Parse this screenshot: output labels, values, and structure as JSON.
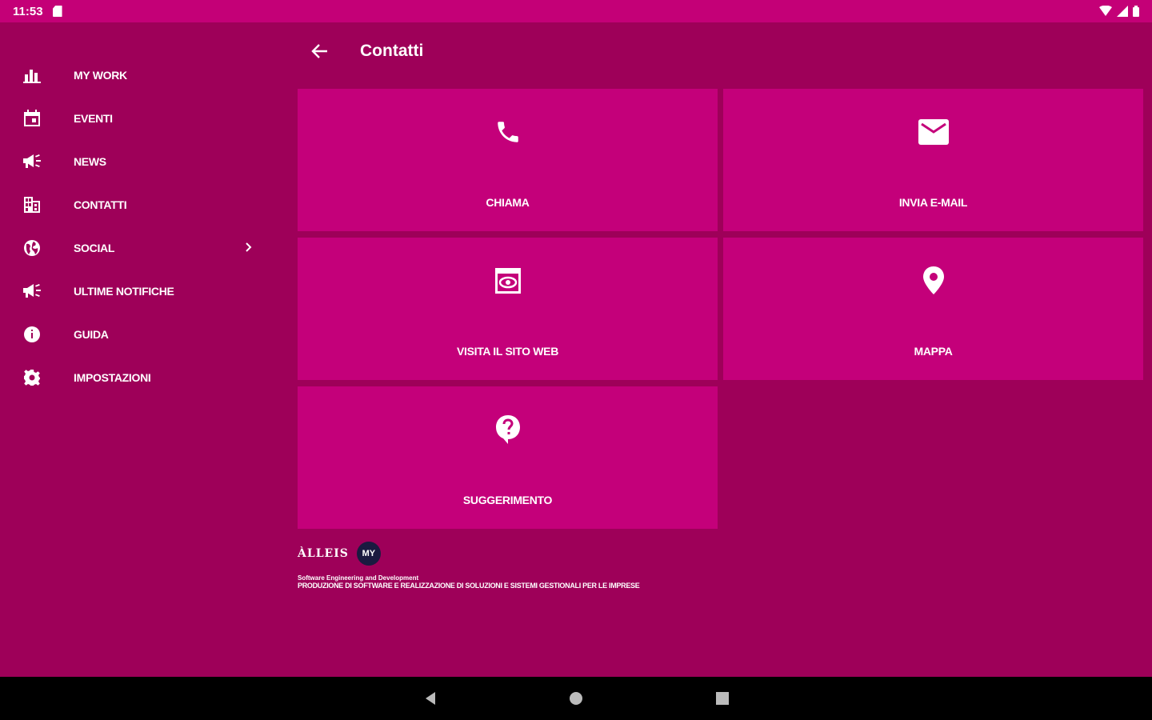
{
  "status_bar": {
    "time": "11:53"
  },
  "drawer": {
    "items": [
      {
        "label": "MY WORK",
        "icon": "bar-chart-icon"
      },
      {
        "label": "EVENTI",
        "icon": "calendar-icon"
      },
      {
        "label": "NEWS",
        "icon": "megaphone-icon"
      },
      {
        "label": "CONTATTI",
        "icon": "business-icon"
      },
      {
        "label": "SOCIAL",
        "icon": "globe-icon"
      },
      {
        "label": "ULTIME NOTIFICHE",
        "icon": "megaphone-icon"
      },
      {
        "label": "GUIDA",
        "icon": "info-icon"
      },
      {
        "label": "IMPOSTAZIONI",
        "icon": "gear-icon"
      }
    ]
  },
  "toolbar": {
    "title": "Contatti"
  },
  "tiles": [
    {
      "label": "CHIAMA",
      "icon": "phone-icon"
    },
    {
      "label": "INVIA E-MAIL",
      "icon": "mail-icon"
    },
    {
      "label": "VISITA IL SITO WEB",
      "icon": "web-view-icon"
    },
    {
      "label": "MAPPA",
      "icon": "map-pin-icon"
    },
    {
      "label": "SUGGERIMENTO",
      "icon": "help-bubble-icon"
    }
  ],
  "footer": {
    "logo_text": "ÀLLEIS",
    "logo_badge": "MY",
    "line1": "Software Engineering and Development",
    "line2": "PRODUZIONE DI SOFTWARE E REALIZZAZIONE DI SOLUZIONI E SISTEMI GESTIONALI PER LE IMPRESE"
  },
  "colors": {
    "background": "#9e0059",
    "tile": "#c4007a",
    "status_bar": "#c40077",
    "nav_bar": "#000000"
  }
}
